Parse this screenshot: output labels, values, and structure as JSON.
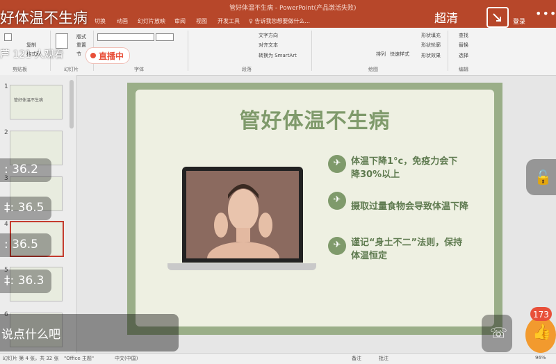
{
  "ppt": {
    "window_title": "管好体温不生病 - PowerPoint(产品激活失败)",
    "tabs": [
      "切换",
      "动画",
      "幻灯片放映",
      "审阅",
      "视图",
      "开发工具",
      "♀ 告诉我您想要做什么..."
    ],
    "ribbon": {
      "clipboard": {
        "group": "剪贴板",
        "copy": "复制",
        "format": "格式刷"
      },
      "slides": {
        "group": "幻灯片",
        "layout": "版式",
        "reset": "重置",
        "section": "节"
      },
      "font": {
        "group": "字体"
      },
      "paragraph": {
        "group": "段落",
        "text_dir": "文字方向",
        "align": "对齐文本",
        "smartart": "转换为 SmartArt"
      },
      "drawing": {
        "group": "绘图",
        "arrange": "排列",
        "quick_styles": "快速样式",
        "fill": "形状填充",
        "outline": "形状轮廓",
        "effects": "形状效果"
      },
      "editing": {
        "group": "编辑",
        "find": "查找",
        "replace": "替换",
        "select": "选择"
      }
    },
    "thumbnails": [
      {
        "num": "1",
        "title": "管好体温不生病"
      },
      {
        "num": "2",
        "title": ""
      },
      {
        "num": "3",
        "title": ""
      },
      {
        "num": "4",
        "title": ""
      },
      {
        "num": "5",
        "title": ""
      },
      {
        "num": "6",
        "title": ""
      }
    ],
    "slide": {
      "title": "管好体温不生病",
      "bullets": [
        {
          "line1": "体温下降1°c，免疫力会下",
          "line2": "降30%以上"
        },
        {
          "line1": "摄取过量食物会导致体温下降",
          "line2": ""
        },
        {
          "line1": "谨记“身土不二”法则，保持",
          "line2": "体温恒定"
        }
      ]
    },
    "status": {
      "slide_info": "幻灯片 第 4 张，共 32 张",
      "theme": "\"Office 主题\"",
      "lang": "中文(中国)",
      "notes": "备注",
      "comments": "批注",
      "zoom": "96%"
    }
  },
  "stream": {
    "title": "好体温不生病",
    "host_viewers": "芦    121 人观看",
    "live": "直播中",
    "quality": "超清",
    "login": "登录",
    "more": "•••",
    "danmaku": [
      ": 36.2",
      "‡: 36.5",
      ": 36.5",
      "‡: 36.3"
    ],
    "comment_placeholder": "说点什么吧",
    "like_count": "173"
  }
}
